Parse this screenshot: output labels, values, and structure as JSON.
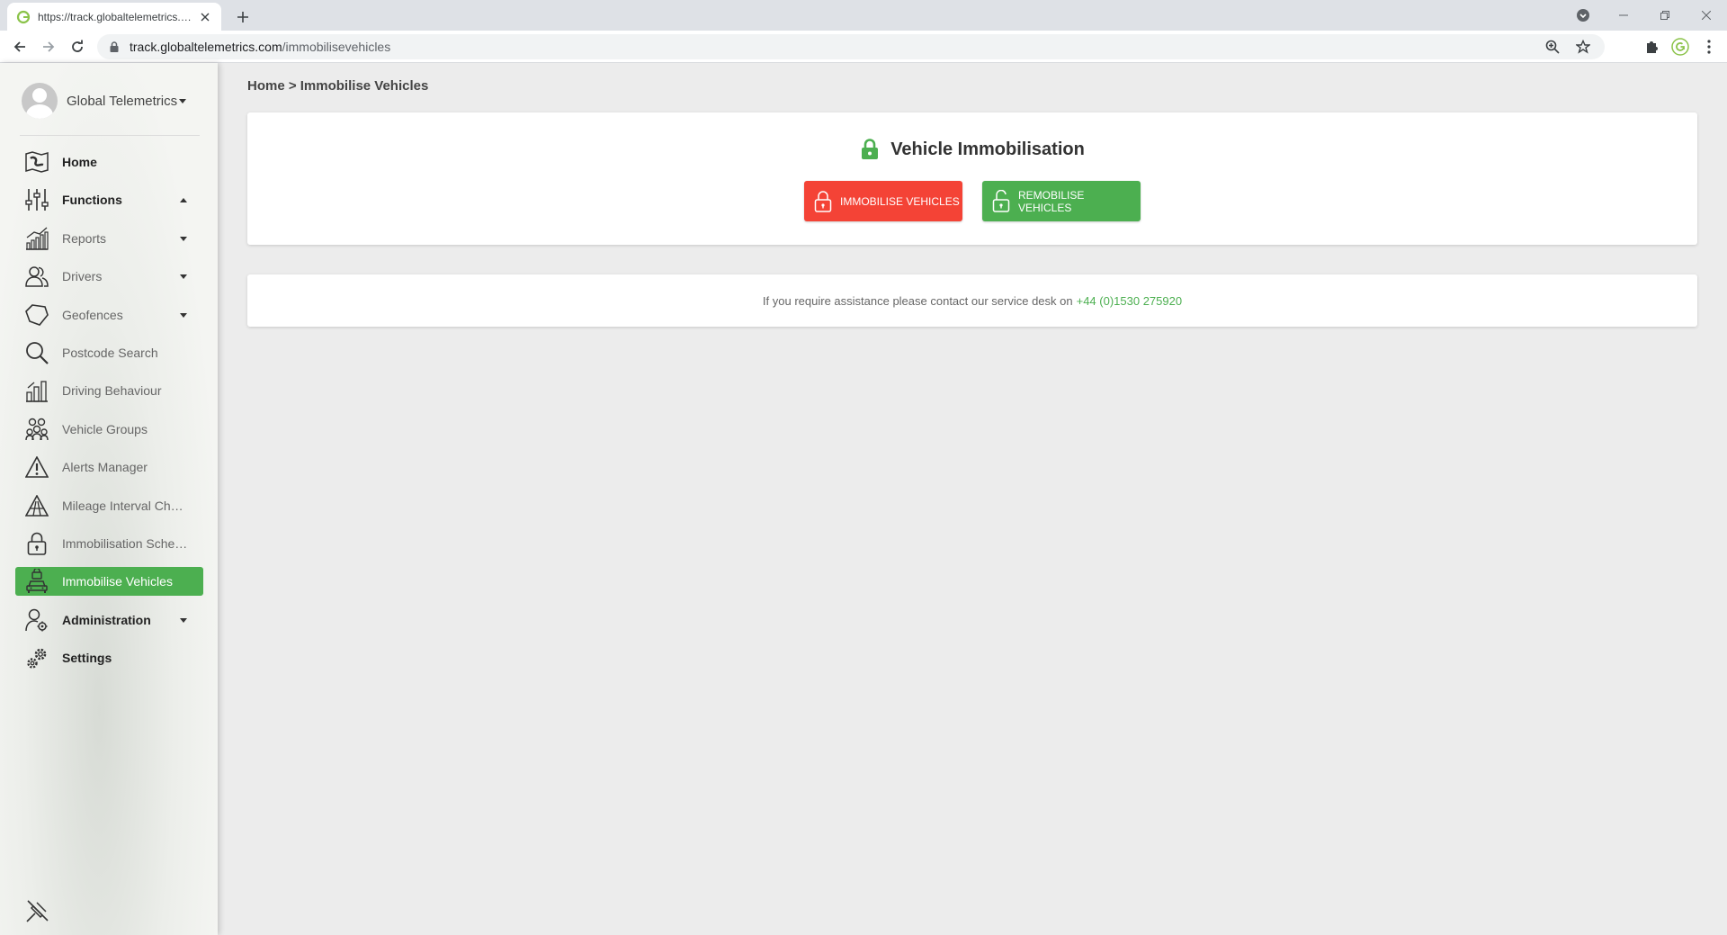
{
  "browser": {
    "tab_title": "https://track.globaltelemetrics.com/immobilisevehicles",
    "url_host": "track.globaltelemetrics.com",
    "url_path": "/immobilisevehicles"
  },
  "sidebar": {
    "user_name": "Global Telemetrics",
    "items": [
      {
        "label": "Home",
        "icon": "map-icon",
        "bold": true
      },
      {
        "label": "Functions",
        "icon": "sliders-icon",
        "bold": true,
        "caret": "up"
      },
      {
        "label": "Reports",
        "icon": "bar-chart-icon",
        "bold": false,
        "caret": "down"
      },
      {
        "label": "Drivers",
        "icon": "users-icon",
        "bold": false,
        "caret": "down"
      },
      {
        "label": "Geofences",
        "icon": "geofence-icon",
        "bold": false,
        "caret": "down"
      },
      {
        "label": "Postcode Search",
        "icon": "search-icon",
        "bold": false
      },
      {
        "label": "Driving Behaviour",
        "icon": "behaviour-chart-icon",
        "bold": false
      },
      {
        "label": "Vehicle Groups",
        "icon": "group-icon",
        "bold": false
      },
      {
        "label": "Alerts Manager",
        "icon": "warning-icon",
        "bold": false
      },
      {
        "label": "Mileage Interval Check",
        "icon": "road-icon",
        "bold": false
      },
      {
        "label": "Immobilisation Schedule",
        "icon": "lock-icon",
        "bold": false
      },
      {
        "label": "Immobilise Vehicles",
        "icon": "car-lock-icon",
        "bold": false,
        "active": true
      },
      {
        "label": "Administration",
        "icon": "admin-user-icon",
        "bold": true,
        "caret": "down"
      },
      {
        "label": "Settings",
        "icon": "gears-icon",
        "bold": true
      }
    ]
  },
  "main": {
    "breadcrumb": "Home > Immobilise Vehicles",
    "card_title": "Vehicle Immobilisation",
    "immobilise_label": "IMMOBILISE VEHICLES",
    "remobilise_label": "REMOBILISE VEHICLES",
    "help_text": "If you require assistance please contact our service desk on",
    "help_phone": "+44 (0)1530 275920"
  },
  "colors": {
    "accent_green": "#4caf50",
    "danger_red": "#f44336"
  }
}
